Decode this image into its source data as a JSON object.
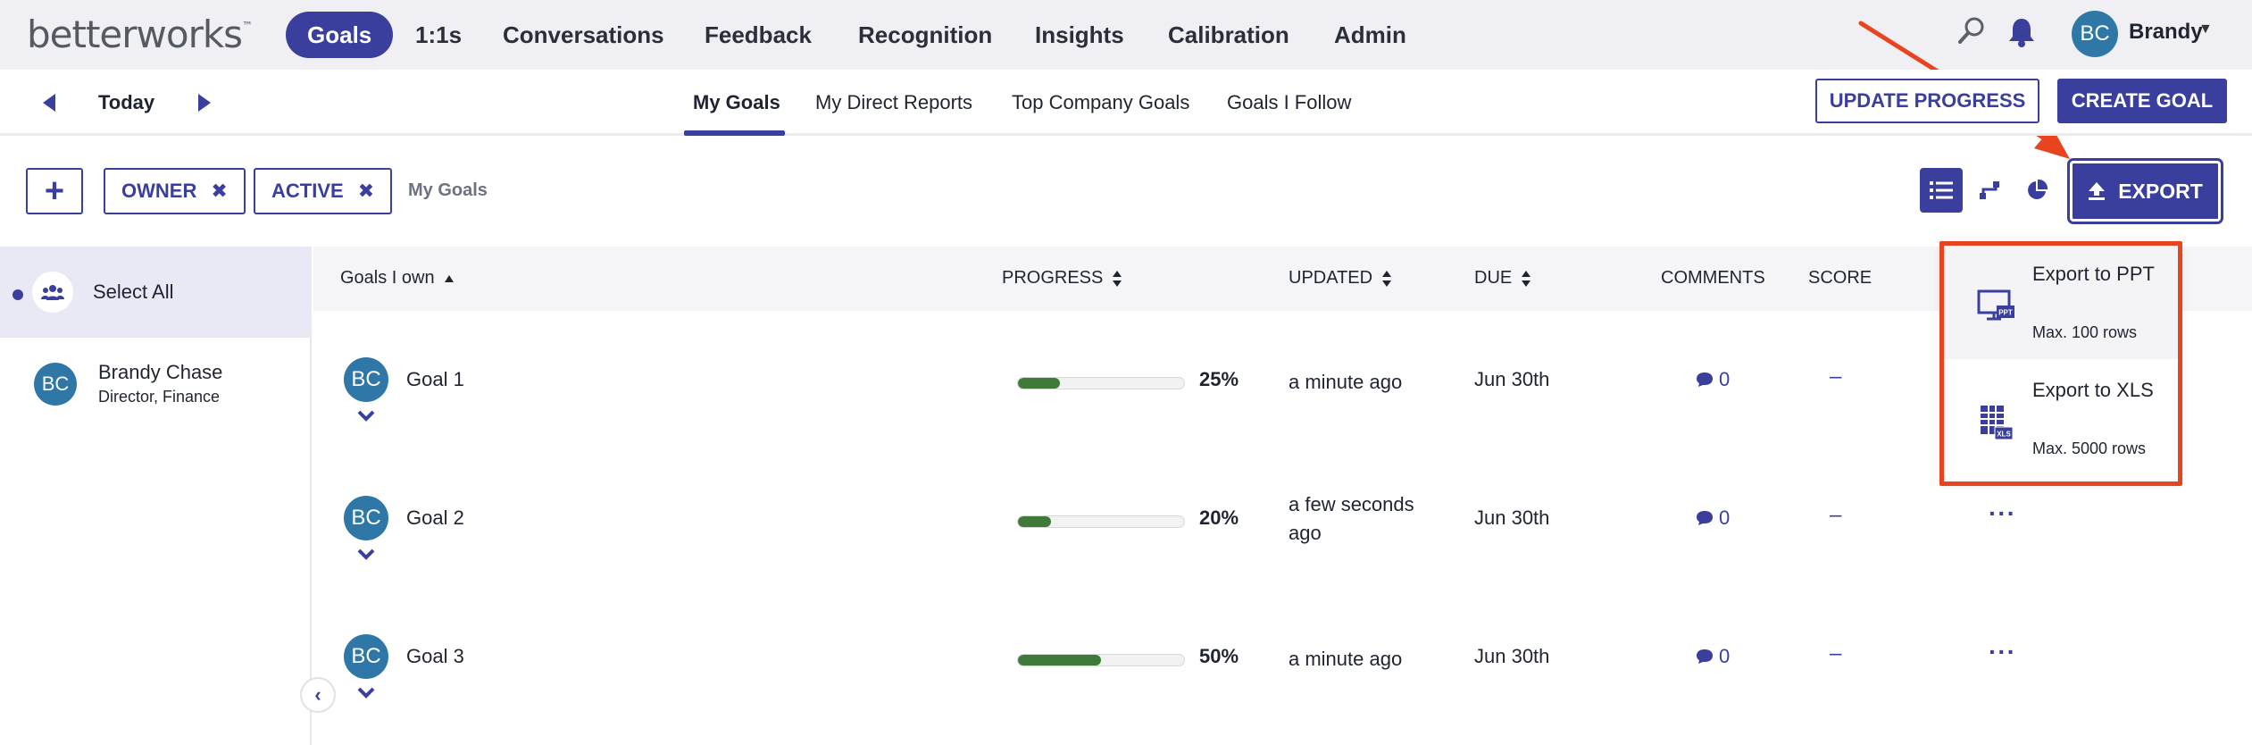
{
  "brand": {
    "logo_text": "betterworks",
    "logo_mark": "™"
  },
  "topnav": {
    "items": [
      {
        "label": "Goals",
        "active": true
      },
      {
        "label": "1:1s"
      },
      {
        "label": "Conversations"
      },
      {
        "label": "Feedback"
      },
      {
        "label": "Recognition"
      },
      {
        "label": "Insights"
      },
      {
        "label": "Calibration"
      },
      {
        "label": "Admin"
      }
    ],
    "icons": [
      "search-icon",
      "bell-icon"
    ],
    "user": {
      "initials": "BC",
      "name": "Brandy"
    }
  },
  "subnav": {
    "date_label": "Today",
    "tabs": [
      {
        "label": "My Goals",
        "active": true
      },
      {
        "label": "My Direct Reports"
      },
      {
        "label": "Top Company Goals"
      },
      {
        "label": "Goals I Follow"
      }
    ],
    "update_progress": "UPDATE PROGRESS",
    "create_goal": "CREATE GOAL"
  },
  "filters": {
    "add": "+",
    "chips": [
      {
        "label": "OWNER"
      },
      {
        "label": "ACTIVE"
      }
    ],
    "remove_glyph": "✖",
    "context_label": "My Goals",
    "export_label": "EXPORT"
  },
  "left_panel": {
    "select_all": "Select All",
    "people": [
      {
        "initials": "BC",
        "name": "Brandy Chase",
        "title": "Director, Finance"
      }
    ]
  },
  "table": {
    "headers": {
      "name": "Goals I own",
      "progress": "PROGRESS",
      "updated": "UPDATED",
      "due": "DUE",
      "comments": "COMMENTS",
      "score": "SCORE"
    },
    "rows": [
      {
        "initials": "BC",
        "name": "Goal 1",
        "progress": 25,
        "progress_label": "25%",
        "updated": "a minute ago",
        "due": "Jun 30th",
        "comments": "0",
        "score": "–",
        "more": ""
      },
      {
        "initials": "BC",
        "name": "Goal 2",
        "progress": 20,
        "progress_label": "20%",
        "updated": "a few seconds ago",
        "due": "Jun 30th",
        "comments": "0",
        "score": "–",
        "more": "···"
      },
      {
        "initials": "BC",
        "name": "Goal 3",
        "progress": 50,
        "progress_label": "50%",
        "updated": "a minute ago",
        "due": "Jun 30th",
        "comments": "0",
        "score": "–",
        "more": "···"
      }
    ]
  },
  "export_menu": {
    "items": [
      {
        "label": "Export to PPT",
        "sub": "Max. 100 rows",
        "icon": "ppt-icon",
        "badge": "PPT"
      },
      {
        "label": "Export to XLS",
        "sub": "Max. 5000 rows",
        "icon": "xls-icon",
        "badge": "XLS"
      }
    ]
  },
  "colors": {
    "primary": "#3a3f9e",
    "avatar": "#2e77a6",
    "progress": "#3f7a3a",
    "annotation": "#e8441f"
  }
}
